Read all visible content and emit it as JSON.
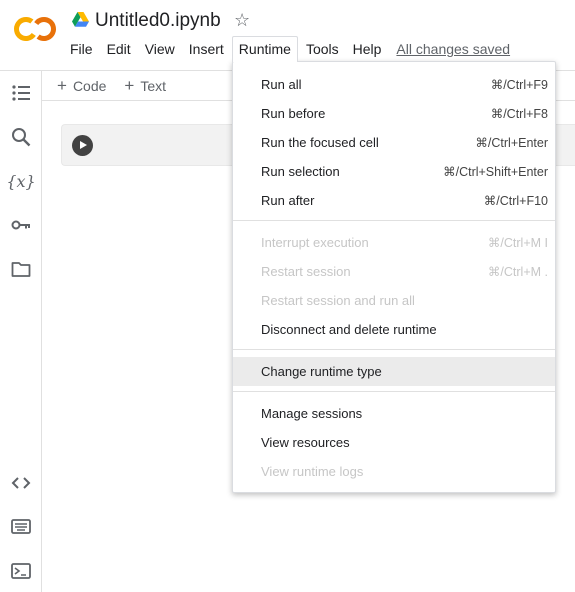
{
  "app": {
    "filename": "Untitled0.ipynb",
    "status": "All changes saved",
    "logo_text": "CO"
  },
  "menubar": {
    "items": [
      "File",
      "Edit",
      "View",
      "Insert",
      "Runtime",
      "Tools",
      "Help"
    ],
    "active": "Runtime"
  },
  "toolbar": {
    "code_label": "Code",
    "text_label": "Text",
    "plus": "+"
  },
  "rail": {
    "var_glyph": "{x}"
  },
  "runtime_menu": {
    "items": [
      {
        "label": "Run all",
        "shortcut": "⌘/Ctrl+F9",
        "enabled": true
      },
      {
        "label": "Run before",
        "shortcut": "⌘/Ctrl+F8",
        "enabled": true
      },
      {
        "label": "Run the focused cell",
        "shortcut": "⌘/Ctrl+Enter",
        "enabled": true
      },
      {
        "label": "Run selection",
        "shortcut": "⌘/Ctrl+Shift+Enter",
        "enabled": true
      },
      {
        "label": "Run after",
        "shortcut": "⌘/Ctrl+F10",
        "enabled": true
      },
      {
        "label": "Interrupt execution",
        "shortcut": "⌘/Ctrl+M I",
        "enabled": false
      },
      {
        "label": "Restart session",
        "shortcut": "⌘/Ctrl+M .",
        "enabled": false
      },
      {
        "label": "Restart session and run all",
        "shortcut": "",
        "enabled": false
      },
      {
        "label": "Disconnect and delete runtime",
        "shortcut": "",
        "enabled": true
      },
      {
        "label": "Change runtime type",
        "shortcut": "",
        "enabled": true,
        "highlighted": true
      },
      {
        "label": "Manage sessions",
        "shortcut": "",
        "enabled": true
      },
      {
        "label": "View resources",
        "shortcut": "",
        "enabled": true
      },
      {
        "label": "View runtime logs",
        "shortcut": "",
        "enabled": false
      }
    ]
  },
  "colors": {
    "logo_orange": "#F9AB00",
    "logo_dark_orange": "#E8710A",
    "highlight_row": "#ebebeb",
    "disabled_text": "#c6c6c6"
  }
}
